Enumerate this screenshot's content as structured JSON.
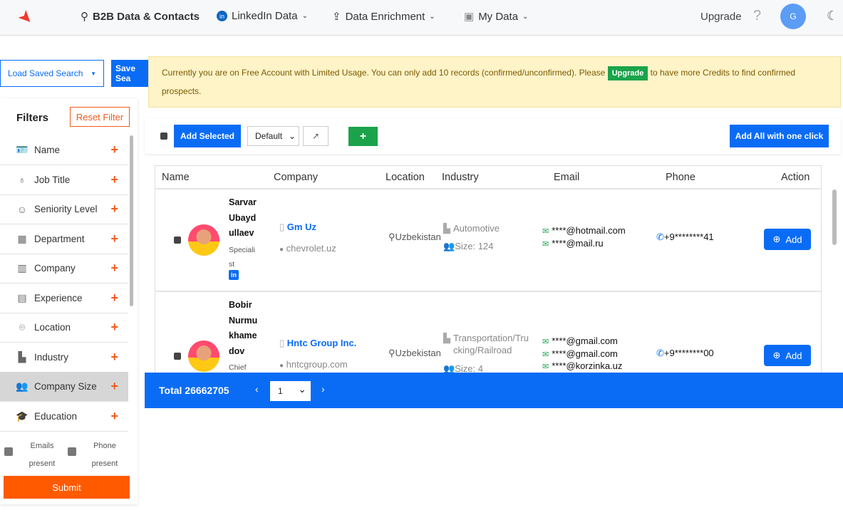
{
  "header": {
    "nav": [
      {
        "label": "B2B Data & Contacts",
        "icon": "search-icon"
      },
      {
        "label": "LinkedIn Data",
        "icon": "linkedin-icon"
      },
      {
        "label": "Data Enrichment",
        "icon": "upload-icon"
      },
      {
        "label": "My Data",
        "icon": "contacts-icon"
      }
    ],
    "upgrade": "Upgrade",
    "help": "?",
    "avatar": "G"
  },
  "search": {
    "load_saved": "Load Saved Search",
    "save": "Save Sea"
  },
  "banner": {
    "text1": "Currently you are on Free Account with Limited Usage. You can only add 10 records (confirmed/unconfirmed). Please",
    "upgrade": "Upgrade",
    "text2": "to have more Credits to find confirmed prospects."
  },
  "filters": {
    "title": "Filters",
    "reset": "Reset Filter",
    "items": [
      "Name",
      "Job Title",
      "Seniority Level",
      "Department",
      "Company",
      "Experience",
      "Location",
      "Industry",
      "Company Size",
      "Education"
    ],
    "emails_present": "Emails present",
    "phone_present": "Phone present",
    "submit": "Submit"
  },
  "toolbar": {
    "add_selected": "Add Selected",
    "view": "Default",
    "add_all": "Add All with one click",
    "plus": "+"
  },
  "table": {
    "columns": [
      "Name",
      "Company",
      "Location",
      "Industry",
      "Email",
      "Phone",
      "Action"
    ],
    "rows": [
      {
        "name": "Sarvar Ubayd ullaev",
        "title": "Speciali st",
        "company": "Gm Uz",
        "domain": "chevrolet.uz",
        "location": "Uzbekistan",
        "industry": "Automotive",
        "size": "Size: 124",
        "emails": [
          "****@hotmail.com",
          "****@mail.ru"
        ],
        "phone": "+9********41",
        "action": "Add"
      },
      {
        "name": "Bobir Nurmu khame dov",
        "title": "Chief",
        "company": "Hntc Group Inc.",
        "domain": "hntcgroup.com",
        "location": "Uzbekistan",
        "industry": "Transportation/Trucking/Railroad",
        "size": "Size: 4",
        "emails": [
          "****@gmail.com",
          "****@gmail.com",
          "****@korzinka.uz"
        ],
        "phone": "+9********00",
        "action": "Add"
      }
    ]
  },
  "footer": {
    "total": "Total 26662705",
    "page": "1"
  },
  "colors": {
    "accent": "#0a6cf5",
    "orange": "#ff5a00",
    "green": "#1aa34a",
    "banner": "#fff3c8"
  }
}
